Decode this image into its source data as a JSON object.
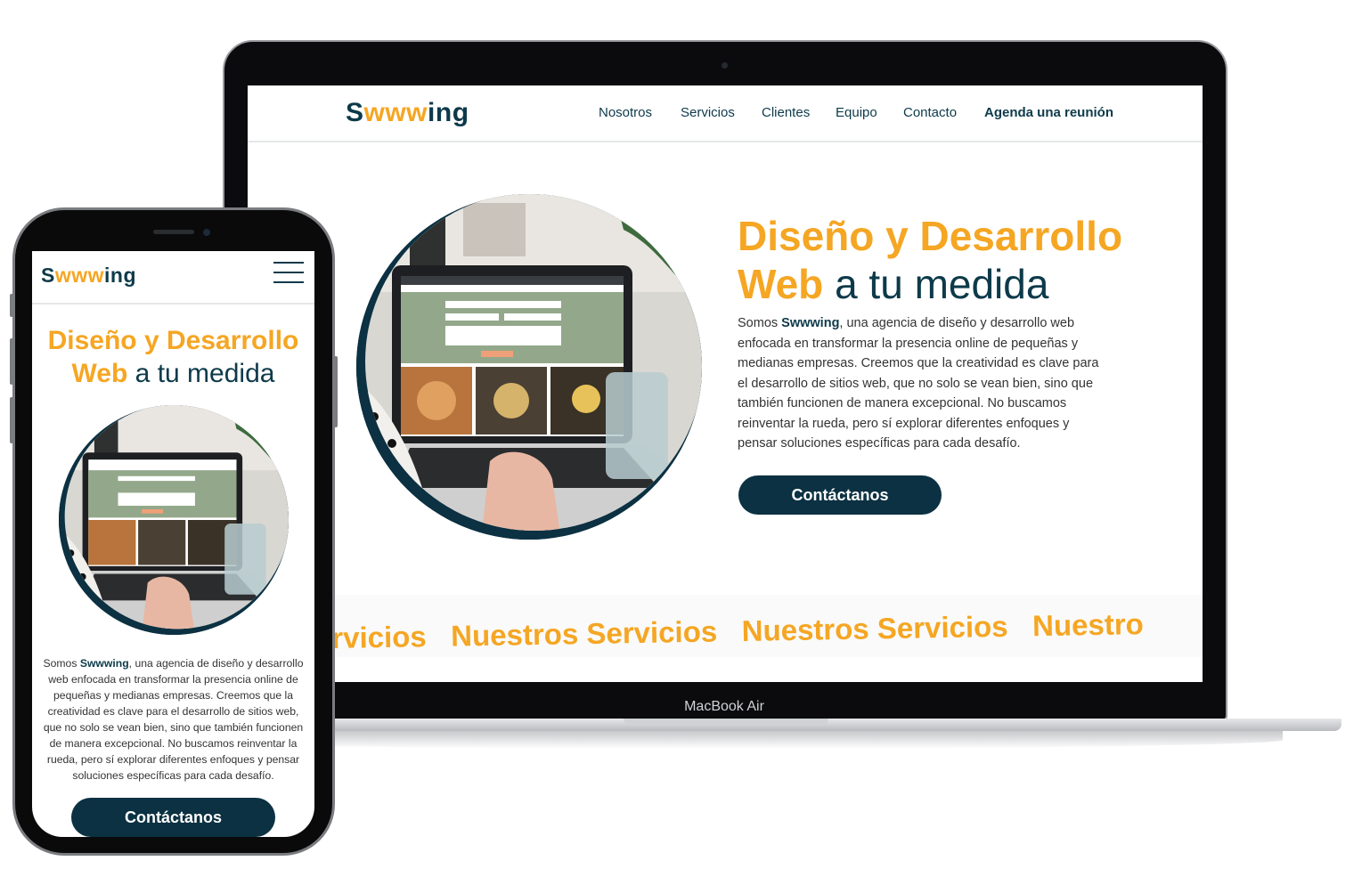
{
  "brand": {
    "logo_prefix": "S",
    "logo_mid": "www",
    "logo_suffix": "ing"
  },
  "nav": {
    "items": [
      "Nosotros",
      "Servicios",
      "Clientes",
      "Equipo",
      "Contacto"
    ],
    "cta": "Agenda una reunión"
  },
  "hero": {
    "title_line1": "Diseño y Desarrollo",
    "title_word": "Web",
    "title_rest": "a tu medida",
    "text_intro": "Somos ",
    "text_brand": "Swwwing",
    "text_body": ", una agencia de diseño y desarrollo web enfocada en transformar la presencia online de pequeñas y medianas empresas. Creemos que la creatividad es clave para el desarrollo de sitios web, que no solo se vean bien, sino que también funcionen de manera excepcional. No buscamos reinventar la rueda, pero sí explorar diferentes enfoques y pensar soluciones específicas para cada desafío.",
    "button": "Contáctanos"
  },
  "marquee": {
    "fragment_start": "rvicios",
    "item": "Nuestros Servicios",
    "fragment_end": "Nuestro"
  },
  "device_label": "MacBook Air",
  "colors": {
    "accent": "#f5a623",
    "navy": "#0d3a4a",
    "button": "#0b3142"
  },
  "icons": {
    "menu": "hamburger-menu-icon"
  }
}
